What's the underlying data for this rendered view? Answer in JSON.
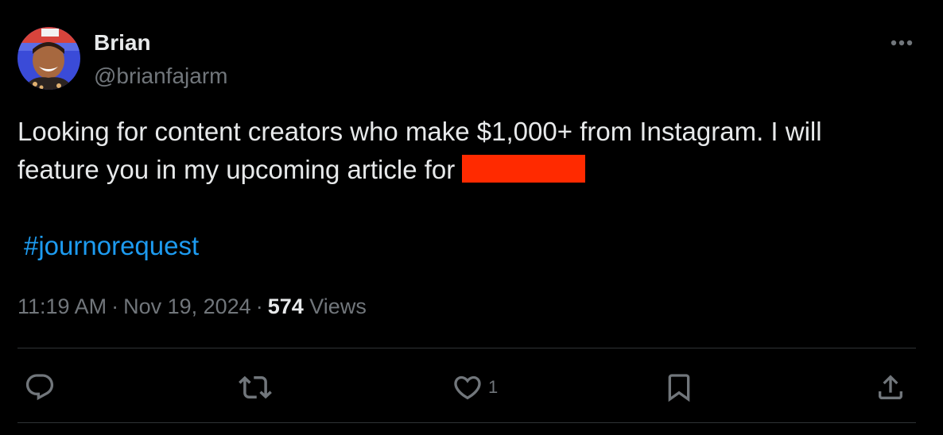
{
  "author": {
    "name": "Brian",
    "handle": "@brianfajarm",
    "avatar_icon": "profile-photo"
  },
  "tweet": {
    "text_line1": "Looking for content creators who make $1,000+ from Instagram. I will",
    "text_line2_prefix": "feature you in my upcoming article for ",
    "hashtag": "#journorequest",
    "redaction_color": "#ff2a00"
  },
  "meta": {
    "time": "11:19 AM",
    "date": "Nov 19, 2024",
    "separator": "·",
    "views_count": "574",
    "views_label": "Views"
  },
  "actions": {
    "reply_icon": "reply-icon",
    "retweet_icon": "retweet-icon",
    "like_icon": "heart-icon",
    "like_count": "1",
    "bookmark_icon": "bookmark-icon",
    "share_icon": "share-icon"
  },
  "colors": {
    "background": "#000000",
    "text": "#e7e9ea",
    "secondary": "#71767b",
    "link": "#1d9bf0",
    "divider": "#2f3336"
  }
}
